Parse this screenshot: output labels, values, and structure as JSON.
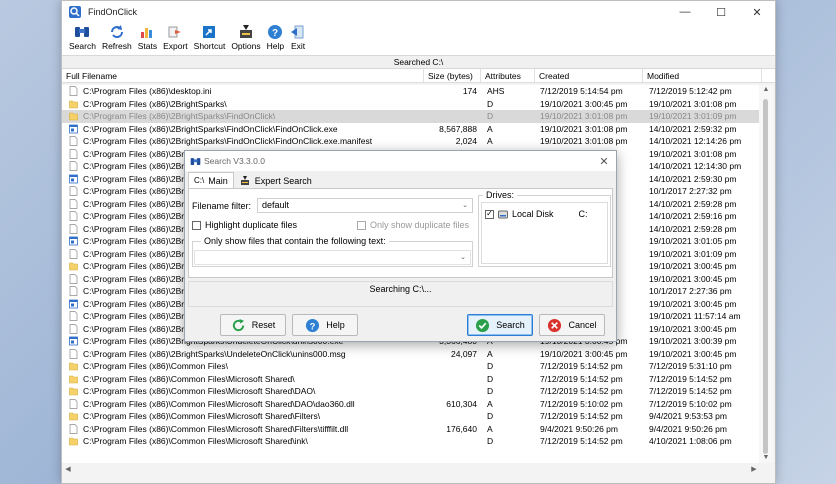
{
  "window": {
    "title": "FindOnClick"
  },
  "toolbar": [
    {
      "id": "search",
      "label": "Search",
      "icon": "binoculars-icon"
    },
    {
      "id": "refresh",
      "label": "Refresh",
      "icon": "refresh-icon"
    },
    {
      "id": "stats",
      "label": "Stats",
      "icon": "stats-icon"
    },
    {
      "id": "export",
      "label": "Export",
      "icon": "export-icon"
    },
    {
      "id": "shortcut",
      "label": "Shortcut",
      "icon": "shortcut-icon"
    },
    {
      "id": "options",
      "label": "Options",
      "icon": "options-icon"
    },
    {
      "id": "help",
      "label": "Help",
      "icon": "help-icon"
    },
    {
      "id": "exit",
      "label": "Exit",
      "icon": "exit-icon"
    }
  ],
  "status_line": "Searched C:\\",
  "columns": {
    "name": "Full Filename",
    "size": "Size (bytes)",
    "attr": "Attributes",
    "created": "Created",
    "modified": "Modified"
  },
  "rows": [
    {
      "icon": "file",
      "name": "C:\\Program Files (x86)\\desktop.ini",
      "size": "174",
      "attr": "AHS",
      "created": "7/12/2019 5:14:54 pm",
      "modified": "7/12/2019 5:12:42 pm"
    },
    {
      "icon": "folder",
      "name": "C:\\Program Files (x86)\\2BrightSparks\\",
      "size": "",
      "attr": "D",
      "created": "19/10/2021 3:00:45 pm",
      "modified": "19/10/2021 3:01:08 pm"
    },
    {
      "icon": "folder",
      "name": "C:\\Program Files (x86)\\2BrightSparks\\FindOnClick\\",
      "size": "",
      "attr": "D",
      "created": "19/10/2021 3:01:08 pm",
      "modified": "19/10/2021 3:01:09 pm",
      "selected": true
    },
    {
      "icon": "exe",
      "name": "C:\\Program Files (x86)\\2BrightSparks\\FindOnClick\\FindOnClick.exe",
      "size": "8,567,888",
      "attr": "A",
      "created": "19/10/2021 3:01:08 pm",
      "modified": "14/10/2021 2:59:32 pm"
    },
    {
      "icon": "file",
      "name": "C:\\Program Files (x86)\\2BrightSparks\\FindOnClick\\FindOnClick.exe.manifest",
      "size": "2,024",
      "attr": "A",
      "created": "19/10/2021 3:01:08 pm",
      "modified": "14/10/2021 12:14:26 pm"
    },
    {
      "icon": "file",
      "name": "C:\\Program Files (x86)\\2Br",
      "size": "",
      "attr": "",
      "created": "",
      "modified": "19/10/2021 3:01:08 pm"
    },
    {
      "icon": "file",
      "name": "C:\\Program Files (x86)\\2Br",
      "size": "",
      "attr": "",
      "created": "",
      "modified": "14/10/2021 12:14:30 pm"
    },
    {
      "icon": "exe",
      "name": "C:\\Program Files (x86)\\2Br",
      "size": "",
      "attr": "",
      "created": "",
      "modified": "14/10/2021 2:59:30 pm"
    },
    {
      "icon": "file",
      "name": "C:\\Program Files (x86)\\2Br",
      "size": "",
      "attr": "",
      "created": "",
      "modified": "10/1/2017 2:27:32 pm"
    },
    {
      "icon": "file",
      "name": "C:\\Program Files (x86)\\2Br",
      "size": "",
      "attr": "",
      "created": "",
      "modified": "14/10/2021 2:59:28 pm"
    },
    {
      "icon": "file",
      "name": "C:\\Program Files (x86)\\2Br",
      "size": "",
      "attr": "",
      "created": "",
      "modified": "14/10/2021 2:59:16 pm"
    },
    {
      "icon": "file",
      "name": "C:\\Program Files (x86)\\2Br",
      "size": "",
      "attr": "",
      "created": "",
      "modified": "14/10/2021 2:59:28 pm"
    },
    {
      "icon": "exe",
      "name": "C:\\Program Files (x86)\\2Br",
      "size": "",
      "attr": "",
      "created": "",
      "modified": "19/10/2021 3:01:05 pm"
    },
    {
      "icon": "file",
      "name": "C:\\Program Files (x86)\\2Br",
      "size": "",
      "attr": "",
      "created": "",
      "modified": "19/10/2021 3:01:09 pm"
    },
    {
      "icon": "folder",
      "name": "C:\\Program Files (x86)\\2Br",
      "size": "",
      "attr": "",
      "created": "",
      "modified": "19/10/2021 3:00:45 pm"
    },
    {
      "icon": "file",
      "name": "C:\\Program Files (x86)\\2Br",
      "size": "",
      "attr": "",
      "created": "",
      "modified": "19/10/2021 3:00:45 pm"
    },
    {
      "icon": "file",
      "name": "C:\\Program Files (x86)\\2Br",
      "size": "",
      "attr": "",
      "created": "",
      "modified": "10/1/2017 2:27:36 pm"
    },
    {
      "icon": "exe",
      "name": "C:\\Program Files (x86)\\2Br",
      "size": "",
      "attr": "",
      "created": "",
      "modified": "19/10/2021 3:00:45 pm"
    },
    {
      "icon": "file",
      "name": "C:\\Program Files (x86)\\2Br",
      "size": "",
      "attr": "",
      "created": "",
      "modified": "19/10/2021 11:57:14 am"
    },
    {
      "icon": "file",
      "name": "C:\\Program Files (x86)\\2Br",
      "size": "",
      "attr": "",
      "created": "",
      "modified": "19/10/2021 3:00:45 pm"
    },
    {
      "icon": "exe",
      "name": "C:\\Program Files (x86)\\2BrightSparks\\UndeleteOnClick\\unins000.exe",
      "size": "3,366,480",
      "attr": "A",
      "created": "19/10/2021 3:00:45 pm",
      "modified": "19/10/2021 3:00:39 pm"
    },
    {
      "icon": "file",
      "name": "C:\\Program Files (x86)\\2BrightSparks\\UndeleteOnClick\\unins000.msg",
      "size": "24,097",
      "attr": "A",
      "created": "19/10/2021 3:00:45 pm",
      "modified": "19/10/2021 3:00:45 pm"
    },
    {
      "icon": "folder",
      "name": "C:\\Program Files (x86)\\Common Files\\",
      "size": "",
      "attr": "D",
      "created": "7/12/2019 5:14:52 pm",
      "modified": "7/12/2019 5:31:10 pm"
    },
    {
      "icon": "folder",
      "name": "C:\\Program Files (x86)\\Common Files\\Microsoft Shared\\",
      "size": "",
      "attr": "D",
      "created": "7/12/2019 5:14:52 pm",
      "modified": "7/12/2019 5:14:52 pm"
    },
    {
      "icon": "folder",
      "name": "C:\\Program Files (x86)\\Common Files\\Microsoft Shared\\DAO\\",
      "size": "",
      "attr": "D",
      "created": "7/12/2019 5:14:52 pm",
      "modified": "7/12/2019 5:14:52 pm"
    },
    {
      "icon": "file",
      "name": "C:\\Program Files (x86)\\Common Files\\Microsoft Shared\\DAO\\dao360.dll",
      "size": "610,304",
      "attr": "A",
      "created": "7/12/2019 5:10:02 pm",
      "modified": "7/12/2019 5:10:02 pm"
    },
    {
      "icon": "folder",
      "name": "C:\\Program Files (x86)\\Common Files\\Microsoft Shared\\Filters\\",
      "size": "",
      "attr": "D",
      "created": "7/12/2019 5:14:52 pm",
      "modified": "9/4/2021 9:53:53 pm"
    },
    {
      "icon": "file",
      "name": "C:\\Program Files (x86)\\Common Files\\Microsoft Shared\\Filters\\tifffilt.dll",
      "size": "176,640",
      "attr": "A",
      "created": "9/4/2021 9:50:26 pm",
      "modified": "9/4/2021 9:50:26 pm"
    },
    {
      "icon": "folder",
      "name": "C:\\Program Files (x86)\\Common Files\\Microsoft Shared\\ink\\",
      "size": "",
      "attr": "D",
      "created": "7/12/2019 5:14:52 pm",
      "modified": "4/10/2021 1:08:06 pm"
    }
  ],
  "dialog": {
    "title": "Search V3.3.0.0",
    "tab_main": "Main",
    "tab_main_prefix": "C:\\",
    "tab_expert": "Expert Search",
    "filename_filter_label": "Filename filter:",
    "filename_filter_value": "default",
    "highlight_dupes": "Highlight duplicate files",
    "only_dupes": "Only show duplicate files",
    "contains_text_label": "Only show files that contain the following text:",
    "contains_text_value": "",
    "drives_label": "Drives:",
    "drive_name": "Local Disk",
    "drive_letter": "C:",
    "status": "Searching C:\\...",
    "reset": "Reset",
    "help": "Help",
    "search": "Search",
    "cancel": "Cancel"
  },
  "colors": {
    "selected_row": "#d9d9d9",
    "accent": "#2d7fd3",
    "folder": "#f5d16a",
    "exe": "#2f6fc9"
  }
}
